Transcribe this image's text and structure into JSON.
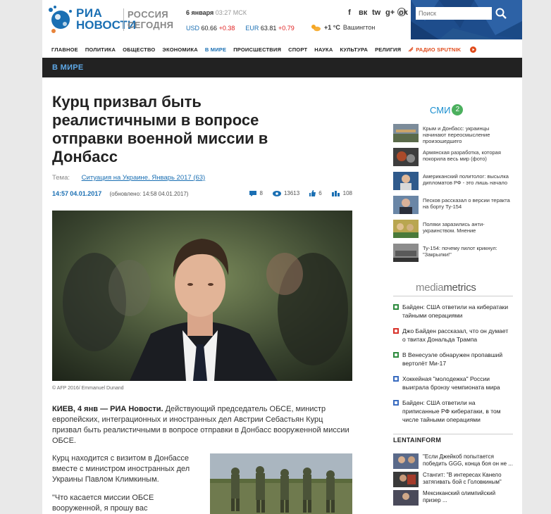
{
  "header": {
    "logo_ria": "РИА",
    "logo_novosti": "НОВОСТИ",
    "logo_rs_line1": "РОССИЯ",
    "logo_rs_line2": "СЕГОДНЯ",
    "date": "6 января",
    "time": "03:27 МСК",
    "usd_label": "USD",
    "usd_value": "60.66",
    "usd_change": "+0.38",
    "eur_label": "EUR",
    "eur_value": "63.81",
    "eur_change": "+0.79",
    "weather_temp": "+1 °C",
    "weather_city": "Вашингтон",
    "search_placeholder": "Поиск",
    "social": [
      "f",
      "вк",
      "tw",
      "g+",
      "ok"
    ]
  },
  "nav": {
    "items": [
      "ГЛАВНОЕ",
      "ПОЛИТИКА",
      "ОБЩЕСТВО",
      "ЭКОНОМИКА",
      "В МИРЕ",
      "ПРОИСШЕСТВИЯ",
      "СПОРТ",
      "НАУКА",
      "КУЛЬТУРА",
      "РЕЛИГИЯ"
    ],
    "active_index": 4,
    "sputnik": "РАДИО SPUTNIK"
  },
  "section": {
    "title": "В МИРЕ"
  },
  "article": {
    "title": "Курц призвал быть реалистичными в вопросе отправки военной миссии в Донбасс",
    "tema_label": "Тема:",
    "tema_link": "Ситуация на Украине. Январь 2017 (63)",
    "time": "14:57",
    "date": "04.01.2017",
    "updated": "(обновлено: 14:58 04.01.2017)",
    "comments": "8",
    "views": "13613",
    "likes": "6",
    "shares": "108",
    "photo_caption": "© AFP 2016/ Emmanuel Dunand",
    "lead_bold": "КИЕВ, 4 янв — РИА Новости.",
    "lead_text": " Действующий председатель ОБСЕ, министр европейских, интеграционных и иностранных дел Австрии Себастьян Курц призвал быть реалистичными в вопросе отправки в Донбасс вооруженной миссии ОБСЕ.",
    "para2": "Курц находится с визитом в Донбассе вместе с министром иностранных дел Украины Павлом Климкиным.",
    "para3": "\"Что касается миссии ОБСЕ вооруженной, я прошу вас"
  },
  "sidebar": {
    "smi_label": "СМИ",
    "smi_num": "2",
    "smi_items": [
      "Крым и Донбасс: украинцы начинают переосмысление произошедшего",
      "Армянская разработка, которая покорила весь мир (фото)",
      "Американский политолог: высылка дипломатов РФ - это лишь начало",
      "Песков рассказал о версии теракта на борту Ту-154",
      "Поляки заразились анти-украинством. Мнение",
      "Ту-154: почему пилот крикнул: \"Закрылки!\""
    ],
    "mm_logo_a": "media",
    "mm_logo_b": "metrics",
    "mm_items": [
      "Байден: США ответили на кибератаки тайными операциями",
      "Джо Байден рассказал, что он думает о твитах Дональда Трампа",
      "В Венесуэле обнаружен пропавший вертолёт Ми-17",
      "Хоккейная \"молодежка\" России выиграла бронзу чемпионата мира",
      "Байден: США ответили на приписанные РФ кибератаки, в том числе тайными операциями"
    ],
    "lenta_head": "LENTAINFORM",
    "lenta_items": [
      "\"Если Джейкоб попытается победить GGG, конца боя он не ...",
      "Стангит: \"В интересах Канело затягивать бой с Головкиным\"",
      "Мексиканский олимпийский призер ..."
    ]
  },
  "colors": {
    "brand_blue": "#1a6fb3",
    "header_dark_blue": "#1e4d8c",
    "section_bar": "#222222",
    "section_text": "#5ea8e6",
    "smi_badge": "#4cb05e",
    "change_red": "#e02020"
  }
}
